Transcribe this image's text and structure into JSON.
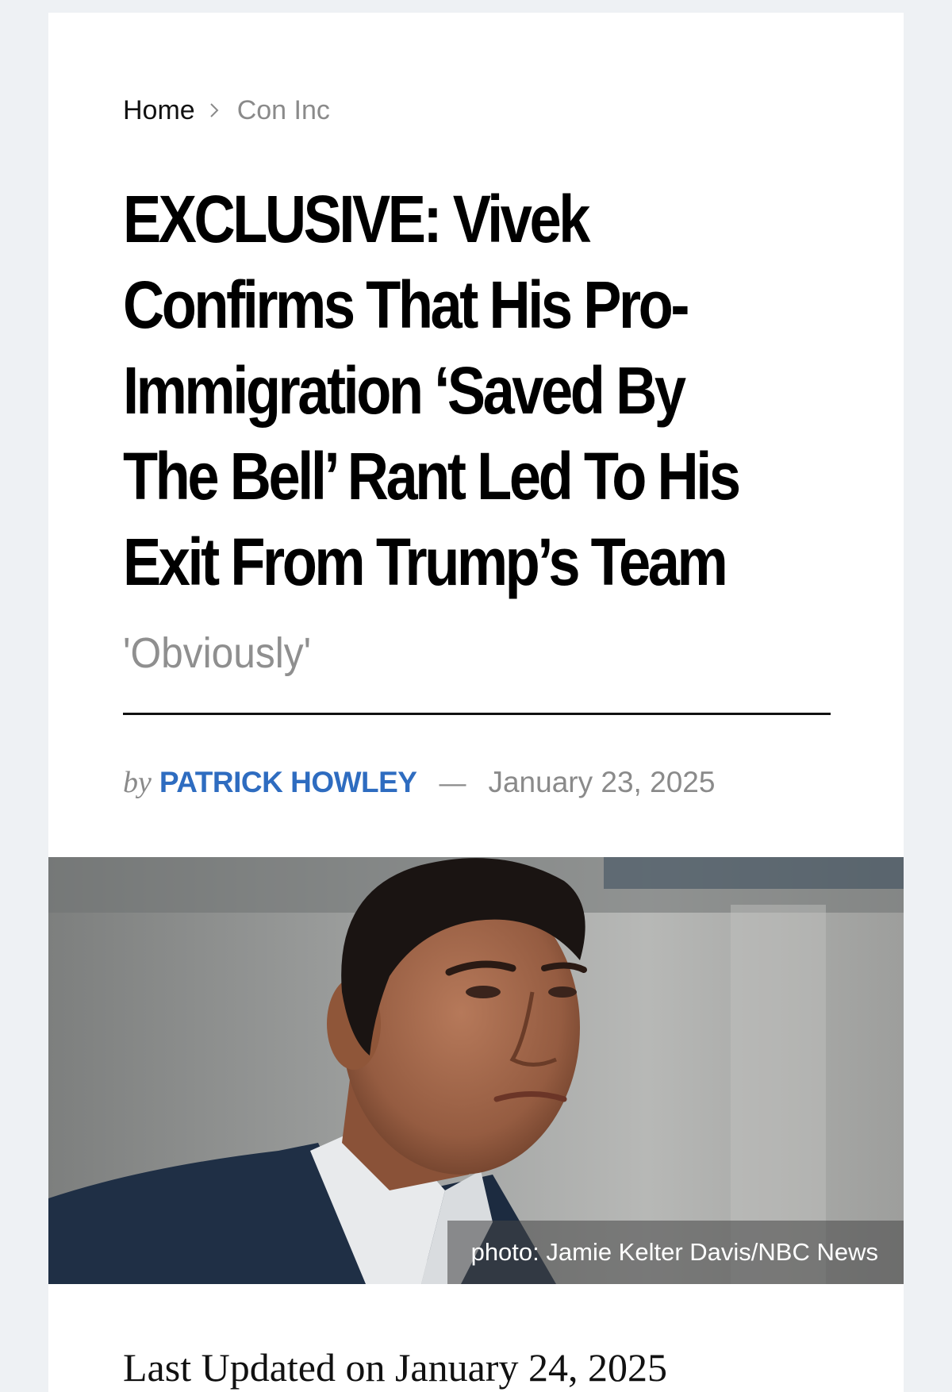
{
  "breadcrumb": {
    "home": "Home",
    "current": "Con Inc"
  },
  "article": {
    "headline": "EXCLUSIVE: Vivek Confirms That His Pro-Immigration ‘Saved By The Bell’ Rant Led To His Exit From Trump’s Team",
    "headline_lines": [
      "EXCLUSIVE: Vivek",
      "Confirms That His Pro-",
      "Immigration ‘Saved By",
      "The Bell’ Rant Led To His",
      "Exit From Trump’s Team"
    ],
    "subtitle": "'Obviously'",
    "byline": {
      "prefix": "by",
      "author": "PATRICK HOWLEY",
      "separator": "—",
      "date": "January 23, 2025"
    },
    "image": {
      "caption": "photo: Jamie Kelter Davis/NBC News"
    },
    "last_updated": "Last Updated on January 24, 2025"
  },
  "colors": {
    "background": "#eef1f4",
    "card": "#ffffff",
    "author_link": "#2e6cc0",
    "muted_text": "#8a8a8a"
  }
}
